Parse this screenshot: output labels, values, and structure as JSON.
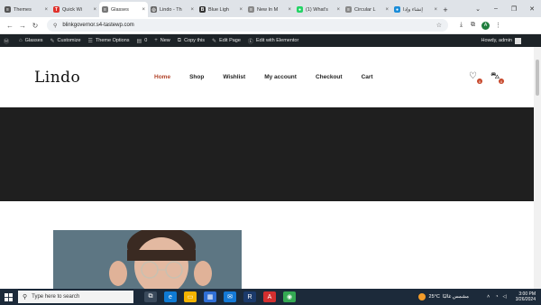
{
  "browser": {
    "tabs": [
      {
        "title": "Themes",
        "color": "#555555",
        "glyph": "≡"
      },
      {
        "title": "Quick Wi",
        "color": "#e0312b",
        "glyph": "T"
      },
      {
        "title": "Glasses",
        "color": "#777777",
        "glyph": "≡",
        "active": true
      },
      {
        "title": "Lindo - Th",
        "color": "#666666",
        "glyph": "◎"
      },
      {
        "title": "Blue Ligh",
        "color": "#333333",
        "glyph": "B"
      },
      {
        "title": "New In M",
        "color": "#888888",
        "glyph": "≡"
      },
      {
        "title": "(1) What's",
        "color": "#25d366",
        "glyph": "●"
      },
      {
        "title": "Circular L",
        "color": "#888888",
        "glyph": "≡"
      },
      {
        "title": "إنشاء وإدا",
        "color": "#1a8cd8",
        "glyph": "●"
      }
    ],
    "new_tab": "+",
    "window_controls": [
      "⌄",
      "–",
      "❐",
      "✕"
    ],
    "url": "blinkgovernor.s4-tastewp.com",
    "profile_initial": "A"
  },
  "admin_bar": {
    "items": [
      {
        "icon": "Ⓦ",
        "label": ""
      },
      {
        "icon": "⌂",
        "label": "Glasses"
      },
      {
        "icon": "✎",
        "label": "Customize"
      },
      {
        "icon": "☰",
        "label": "Theme Options"
      },
      {
        "icon": "▤",
        "label": "0"
      },
      {
        "icon": "+",
        "label": "New"
      },
      {
        "icon": "⧉",
        "label": "Copy this"
      },
      {
        "icon": "✎",
        "label": "Edit Page"
      },
      {
        "icon": "Ⓔ",
        "label": "Edit with Elementor"
      }
    ],
    "greeting": "Howdy, admin"
  },
  "site": {
    "logo": "Lindo",
    "menu": [
      "Home",
      "Shop",
      "Wishlist",
      "My account",
      "Checkout",
      "Cart"
    ],
    "active_menu": "Home",
    "wishlist_count": "0",
    "cart_count": "0"
  },
  "taskbar": {
    "search_placeholder": "Type here to search",
    "weather_temp": "25°C",
    "weather_text": "مشمس غالبًا",
    "time": "3:00 PM",
    "date": "3/26/2024",
    "apps": [
      {
        "name": "task-view",
        "color": "#3a4a5c",
        "glyph": "⧉"
      },
      {
        "name": "edge",
        "color": "#0f7bd4",
        "glyph": "e"
      },
      {
        "name": "file-explorer",
        "color": "#f4b400",
        "glyph": "▭"
      },
      {
        "name": "store",
        "color": "#2f6fd6",
        "glyph": "▦"
      },
      {
        "name": "mail",
        "color": "#1479d6",
        "glyph": "✉"
      },
      {
        "name": "r-app",
        "color": "#1b3a6b",
        "glyph": "R"
      },
      {
        "name": "acrobat",
        "color": "#d32f2f",
        "glyph": "A"
      },
      {
        "name": "chrome",
        "color": "#34a853",
        "glyph": "◉"
      }
    ]
  }
}
